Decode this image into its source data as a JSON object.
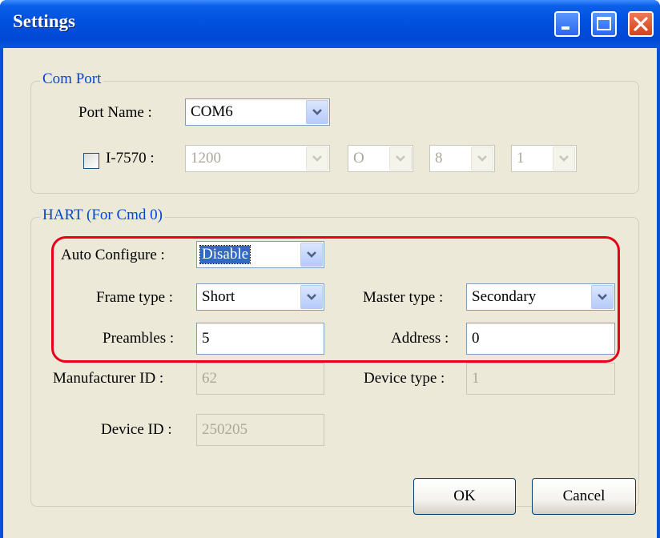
{
  "window": {
    "title": "Settings"
  },
  "com_port": {
    "legend": "Com Port",
    "port_name_label": "Port Name :",
    "port_name_value": "COM6",
    "i7570_label": "I-7570 :",
    "i7570_checked": false,
    "baud_value": "1200",
    "parity_value": "O",
    "databits_value": "8",
    "stopbits_value": "1"
  },
  "hart": {
    "legend": "HART (For Cmd 0)",
    "auto_configure_label": "Auto Configure :",
    "auto_configure_value": "Disable",
    "frame_type_label": "Frame type :",
    "frame_type_value": "Short",
    "master_type_label": "Master type :",
    "master_type_value": "Secondary",
    "preambles_label": "Preambles :",
    "preambles_value": "5",
    "address_label": "Address :",
    "address_value": "0",
    "manufacturer_id_label": "Manufacturer ID :",
    "manufacturer_id_value": "62",
    "device_type_label": "Device type :",
    "device_type_value": "1",
    "device_id_label": "Device ID :",
    "device_id_value": "250205"
  },
  "buttons": {
    "ok_label": "OK",
    "cancel_label": "Cancel"
  },
  "colors": {
    "titlebar": "#0053e0",
    "client_bg": "#ece9d8",
    "legend_text": "#0046d5",
    "highlight": "#e8001a"
  }
}
